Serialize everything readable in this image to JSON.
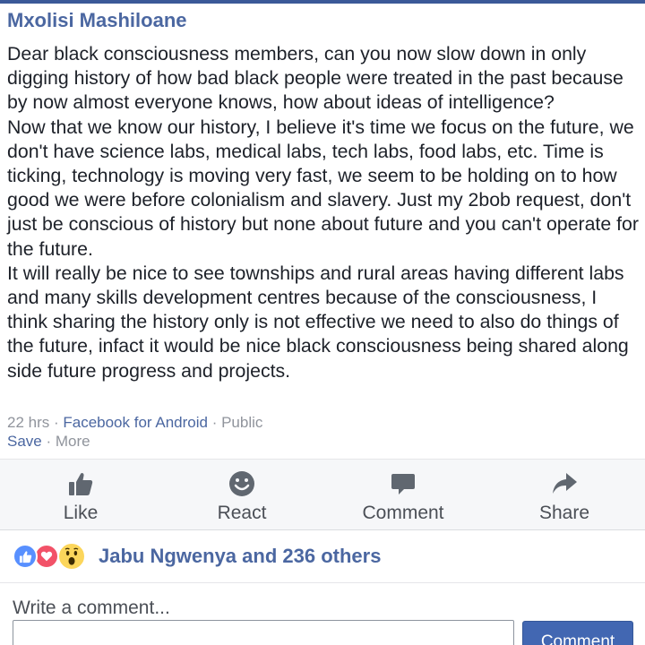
{
  "post": {
    "author": "Mxolisi Mashiloane",
    "paragraphs": [
      "Dear black consciousness members, can you now slow down in only digging history of how bad black people were treated in the past because by now almost everyone knows, how about ideas of intelligence?",
      "Now that we know our history, I believe it's time we focus on the future, we don't have science labs, medical labs, tech labs, food labs, etc. Time is ticking, technology is moving very fast, we seem to be holding on to how good we were before colonialism and slavery. Just my 2bob request, don't just be conscious of history but none about future and you can't operate for the future.",
      "It will really be nice to see townships and rural areas having different labs and many skills development centres because of the consciousness, I think sharing the history only is not effective we need to also do things of the future, infact it would be nice black consciousness being shared along side future progress and projects."
    ],
    "time": "22 hrs",
    "separator": " · ",
    "source": "Facebook for Android",
    "privacy": "Public",
    "save_label": "Save",
    "more_label": "More"
  },
  "actions": {
    "like": "Like",
    "react": "React",
    "comment": "Comment",
    "share": "Share"
  },
  "reactions": {
    "icons": [
      "like-icon",
      "love-icon",
      "wow-icon"
    ],
    "text": "Jabu Ngwenya and 236 others"
  },
  "comment_box": {
    "label": "Write a comment...",
    "value": "",
    "button": "Comment"
  },
  "colors": {
    "brand": "#3b5998",
    "link": "#4b67a1",
    "button": "#4267b2",
    "like": "#5890ff",
    "love": "#f25268",
    "wow": "#fcd65b"
  }
}
